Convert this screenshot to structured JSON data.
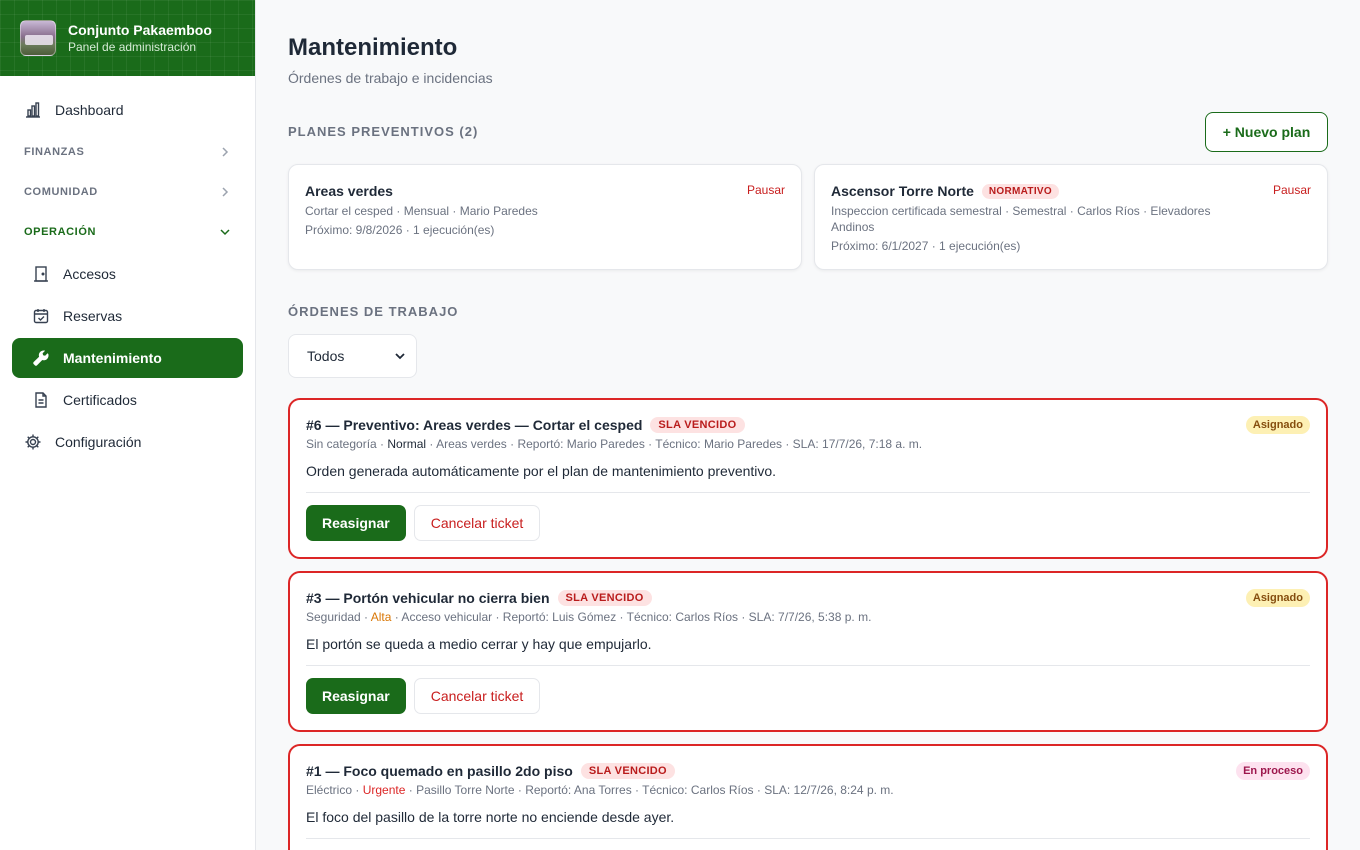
{
  "brand": {
    "title": "Conjunto Pakaemboo",
    "subtitle": "Panel de administración"
  },
  "sidebar": {
    "dashboard": "Dashboard",
    "groups": {
      "finanzas": "FINANZAS",
      "comunidad": "COMUNIDAD",
      "operacion": "OPERACIÓN"
    },
    "operacion_items": [
      "Accesos",
      "Reservas",
      "Mantenimiento",
      "Certificados"
    ],
    "configuracion": "Configuración"
  },
  "page": {
    "title": "Mantenimiento",
    "subtitle": "Órdenes de trabajo e incidencias"
  },
  "plans": {
    "section_label": "PLANES PREVENTIVOS (2)",
    "new_button": "+ Nuevo plan",
    "items": [
      {
        "name": "Areas verdes",
        "badge": "",
        "desc": "Cortar el cesped · Mensual · Mario Paredes",
        "next": "Próximo: 9/8/2026 · 1 ejecución(es)",
        "action": "Pausar"
      },
      {
        "name": "Ascensor Torre Norte",
        "badge": "NORMATIVO",
        "desc": "Inspeccion certificada semestral · Semestral · Carlos Ríos · Elevadores Andinos",
        "next": "Próximo: 6/1/2027 · 1 ejecución(es)",
        "action": "Pausar"
      }
    ]
  },
  "orders": {
    "section_label": "ÓRDENES DE TRABAJO",
    "filter_value": "Todos",
    "items": [
      {
        "title": "#6 — Preventivo: Areas verdes — Cortar el cesped",
        "sla": "SLA VENCIDO",
        "status": "Asignado",
        "category": "Sin categoría",
        "priority": "Normal",
        "rest": "· Areas verdes · Reportó: Mario Paredes · Técnico: Mario Paredes · SLA: 17/7/26, 7:18 a. m.",
        "desc": "Orden generada automáticamente por el plan de mantenimiento preventivo.",
        "primary": "Reasignar",
        "cancel": "Cancelar ticket"
      },
      {
        "title": "#3 — Portón vehicular no cierra bien",
        "sla": "SLA VENCIDO",
        "status": "Asignado",
        "category": "Seguridad",
        "priority": "Alta",
        "rest": "· Acceso vehicular · Reportó: Luis Gómez · Técnico: Carlos Ríos · SLA: 7/7/26, 5:38 p. m.",
        "desc": "El portón se queda a medio cerrar y hay que empujarlo.",
        "primary": "Reasignar",
        "cancel": "Cancelar ticket"
      },
      {
        "title": "#1 — Foco quemado en pasillo 2do piso",
        "sla": "SLA VENCIDO",
        "status": "En proceso",
        "category": "Eléctrico",
        "priority": "Urgente",
        "rest": "· Pasillo Torre Norte · Reportó: Ana Torres · Técnico: Carlos Ríos · SLA: 12/7/26, 8:24 p. m.",
        "desc": "El foco del pasillo de la torre norte no enciende desde ayer."
      }
    ]
  },
  "colors": {
    "brand": "#1a6b1a",
    "danger": "#dc2626"
  }
}
